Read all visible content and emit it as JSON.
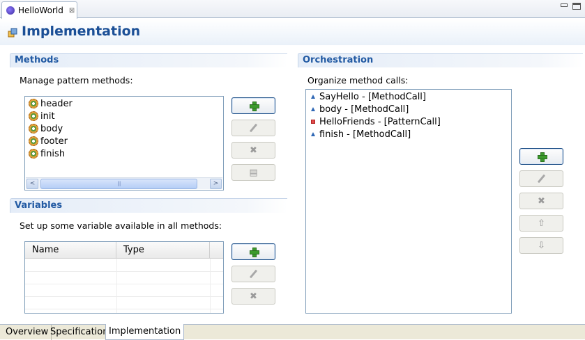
{
  "editor": {
    "tab_title": "HelloWorld",
    "tab_close": "⊠"
  },
  "form": {
    "title": "Implementation"
  },
  "methods": {
    "title": "Methods",
    "description": "Manage pattern methods:",
    "items": [
      "header",
      "init",
      "body",
      "footer",
      "finish"
    ]
  },
  "variables": {
    "title": "Variables",
    "description": "Set up some variable available in all methods:",
    "columns": [
      "Name",
      "Type"
    ]
  },
  "orchestration": {
    "title": "Orchestration",
    "description": "Organize method calls:",
    "items": [
      {
        "label": "SayHello - [MethodCall]",
        "kind": "method-call"
      },
      {
        "label": "body - [MethodCall]",
        "kind": "method-call"
      },
      {
        "label": "HelloFriends - [PatternCall]",
        "kind": "pattern-call"
      },
      {
        "label": "finish - [MethodCall]",
        "kind": "method-call"
      }
    ]
  },
  "scrollbar": {
    "left_arrow": "<",
    "right_arrow": ">",
    "thumb_grip": "|||"
  },
  "button_icons": {
    "delete": "✖",
    "up": "⇧",
    "down": "⇩",
    "override": "▤"
  },
  "bottom_tabs": [
    "Overview",
    "Specification",
    "Implementation"
  ],
  "colors": {
    "title_blue": "#1b4f96",
    "section_blue": "#225aa3",
    "add_green": "#3c9a2c"
  }
}
